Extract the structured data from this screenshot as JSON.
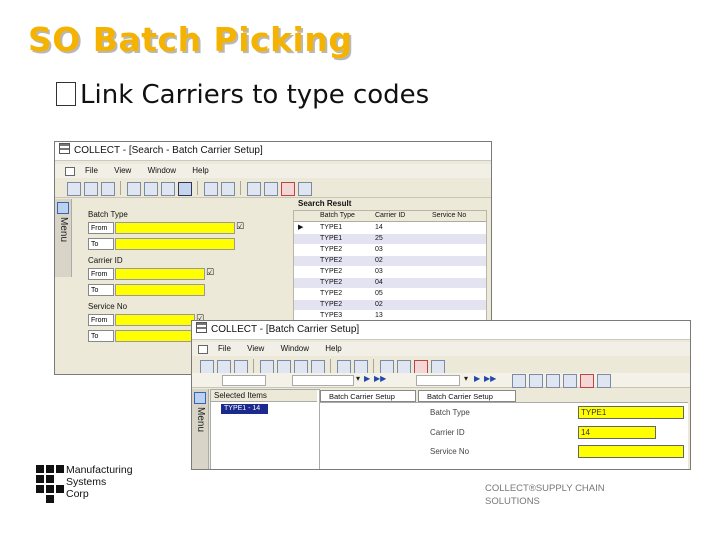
{
  "slide": {
    "title": "SO Batch Picking",
    "bullet_text": "Link Carriers to  type codes",
    "footer_line1": "COLLECT®SUPPLY CHAIN",
    "footer_line2": "SOLUTIONS"
  },
  "logo": {
    "line1": "Manufacturing",
    "line2": "Systems",
    "line3": "Corp"
  },
  "win1": {
    "title": "COLLECT - [Search - Batch Carrier Setup]",
    "menu": [
      "File",
      "View",
      "Window",
      "Help"
    ],
    "side_menu_label": "Menu",
    "batch_type_label": "Batch Type",
    "carrier_id_label": "Carrier ID",
    "service_no_label": "Service No",
    "from_label": "From",
    "to_label": "To",
    "search_result_label": "Search Result",
    "columns": [
      "Batch Type",
      "Carrier ID",
      "Service No"
    ],
    "rows": [
      {
        "batch_type": "TYPE1",
        "carrier_id": "14"
      },
      {
        "batch_type": "TYPE1",
        "carrier_id": "25"
      },
      {
        "batch_type": "TYPE2",
        "carrier_id": "03"
      },
      {
        "batch_type": "TYPE2",
        "carrier_id": "02"
      },
      {
        "batch_type": "TYPE2",
        "carrier_id": "03"
      },
      {
        "batch_type": "TYPE2",
        "carrier_id": "04"
      },
      {
        "batch_type": "TYPE2",
        "carrier_id": "05"
      },
      {
        "batch_type": "TYPE2",
        "carrier_id": "02"
      },
      {
        "batch_type": "TYPE3",
        "carrier_id": "13"
      }
    ]
  },
  "win2": {
    "title": "COLLECT - [Batch Carrier Setup]",
    "menu": [
      "File",
      "View",
      "Window",
      "Help"
    ],
    "side_menu_label": "Menu",
    "selected_items_label": "Selected Items",
    "selected_item_value": "TYPE1 - 14",
    "tab1_label": "Batch Carrier Setup",
    "tab2_label": "Batch Carrier Setup",
    "batch_type_label": "Batch Type",
    "carrier_id_label": "Carrier ID",
    "service_no_label": "Service No",
    "batch_type_value": "TYPE1",
    "carrier_id_value": "14",
    "service_no_value": ""
  },
  "colors": {
    "title": "#f5b300",
    "field_yellow": "#ffff00",
    "alt_row": "#e3e3f1",
    "selected_item_bg": "#1b2a8c"
  },
  "icons": [
    "app-icon",
    "toolbar-icon",
    "checkbox-icon",
    "row-pointer-icon",
    "nav-first-icon",
    "nav-prev-icon",
    "nav-next-icon",
    "nav-last-icon",
    "dropdown-icon"
  ]
}
